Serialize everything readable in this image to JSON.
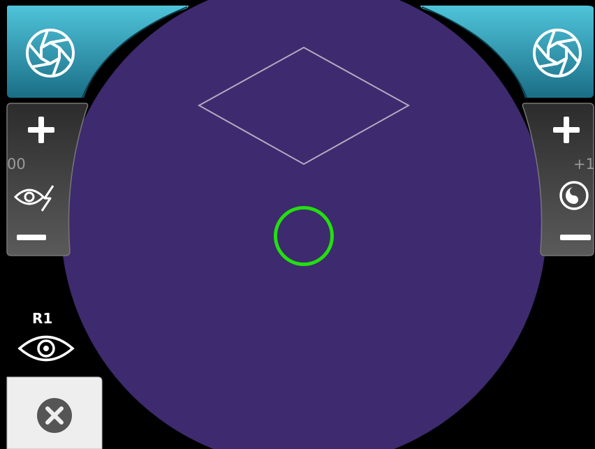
{
  "colors": {
    "background": "#000000",
    "view_circle": "#3e2a6e",
    "reticle": "#22e00e",
    "shutter_button_top": "#4fc4da",
    "shutter_button_bottom": "#1a6e86",
    "control_panel_top": "#2c2c2c",
    "control_panel_bottom": "#5a5a5a",
    "close_button_bg": "#eeeeee",
    "close_icon": "#555555",
    "diamond_outline": "#b3a9c2"
  },
  "left_controls": {
    "shutter_icon": "aperture-icon",
    "increase_icon": "plus-icon",
    "value": "00",
    "mode_icon": "eye-flash-icon",
    "decrease_icon": "minus-icon"
  },
  "right_controls": {
    "shutter_icon": "aperture-icon",
    "increase_icon": "plus-icon",
    "value": "+1",
    "mode_icon": "rotate-icon",
    "decrease_icon": "minus-icon"
  },
  "eye_selector": {
    "label": "R1",
    "icon": "eye-icon"
  },
  "close_button": {
    "icon": "close-icon"
  }
}
